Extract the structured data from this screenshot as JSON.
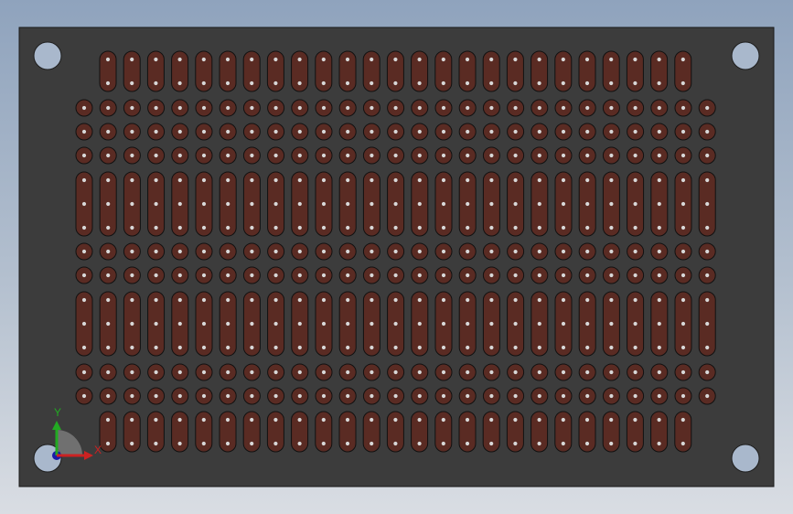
{
  "viewport": {
    "title": ""
  },
  "board": {
    "board_color": "#3c3c3c",
    "pad_color": "#5a2b23",
    "hole_color": "#d8d8d8",
    "mounting_hole_color": "#a9b8cc",
    "pad_columns": 27,
    "strip_columns": 25
  },
  "triad": {
    "x_label": "X",
    "y_label": "Y",
    "x_color": "#cc2222",
    "y_color": "#22aa22",
    "z_color": "#1a1aa8"
  }
}
